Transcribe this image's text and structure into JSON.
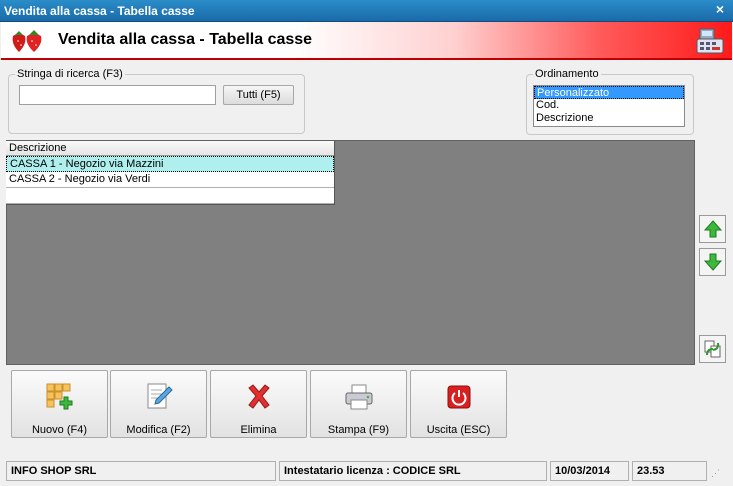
{
  "window": {
    "title": "Vendita alla cassa - Tabella casse",
    "close": "×"
  },
  "header": {
    "title": "Vendita alla cassa - Tabella casse"
  },
  "search": {
    "legend": "Stringa di ricerca (F3)",
    "value": "",
    "button": "Tutti (F5)"
  },
  "ordering": {
    "legend": "Ordinamento",
    "options": [
      "Personalizzato",
      "Cod.",
      "Descrizione"
    ],
    "selected": "Personalizzato"
  },
  "table": {
    "columns": [
      "Descrizione"
    ],
    "rows": [
      "CASSA 1 - Negozio via Mazzini",
      "CASSA 2 - Negozio via Verdi"
    ]
  },
  "side_buttons": [
    "arrow-up-icon",
    "arrow-down-icon",
    "refresh-icon"
  ],
  "toolbar": {
    "new": "Nuovo (F4)",
    "edit": "Modifica (F2)",
    "delete": "Elimina",
    "print": "Stampa (F9)",
    "exit": "Uscita (ESC)"
  },
  "status": {
    "company": "INFO SHOP SRL",
    "license": "Intestatario licenza : CODICE SRL",
    "date": "10/03/2014",
    "time": "23.53"
  },
  "colors": {
    "title_bar": "#1a6aa8",
    "header_red": "#ff1a1a",
    "selection": "#aff0ee",
    "list_selection": "#3399ff"
  }
}
